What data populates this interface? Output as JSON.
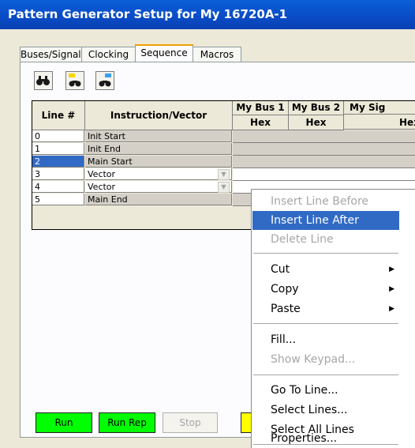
{
  "window": {
    "title": "Pattern Generator Setup for My 16720A-1"
  },
  "tabs": [
    {
      "label": "Buses/Signals"
    },
    {
      "label": "Clocking"
    },
    {
      "label": "Sequence",
      "active": true
    },
    {
      "label": "Macros"
    }
  ],
  "toolbar": {
    "icons": [
      "binoculars-icon",
      "find-previous-icon",
      "find-next-icon"
    ]
  },
  "grid": {
    "headers": {
      "line": "Line #",
      "instr": "Instruction/Vector",
      "bus1": "My Bus 1",
      "bus2": "My Bus 2",
      "sig": "My Sig",
      "format1": "Hex",
      "format2": "Hex",
      "format3": "Hex"
    },
    "rows": [
      {
        "line": "0",
        "instr": "Init Start"
      },
      {
        "line": "1",
        "instr": "Init End"
      },
      {
        "line": "2",
        "instr": "Main Start",
        "selected": true
      },
      {
        "line": "3",
        "instr": "Vector"
      },
      {
        "line": "4",
        "instr": "Vector"
      },
      {
        "line": "5",
        "instr": "Main End"
      }
    ]
  },
  "buttons": {
    "run": "Run",
    "run_rep": "Run Rep",
    "stop": "Stop"
  },
  "context_menu": {
    "items": [
      {
        "label": "Insert Line Before",
        "disabled": true
      },
      {
        "label": "Insert Line After",
        "highlighted": true
      },
      {
        "label": "Delete Line",
        "disabled": true
      },
      {
        "label": "Cut",
        "submenu": true
      },
      {
        "label": "Copy",
        "submenu": true
      },
      {
        "label": "Paste",
        "submenu": true
      },
      {
        "label": "Fill...",
        "disabled": false
      },
      {
        "label": "Show Keypad...",
        "disabled": true
      },
      {
        "label": "Go To Line..."
      },
      {
        "label": "Select Lines..."
      },
      {
        "label": "Select All Lines"
      },
      {
        "label": "Properties..."
      }
    ]
  },
  "colors": {
    "title_bar": "#0a4bc6",
    "highlight": "#316ac5",
    "run_button": "#00ff00"
  }
}
